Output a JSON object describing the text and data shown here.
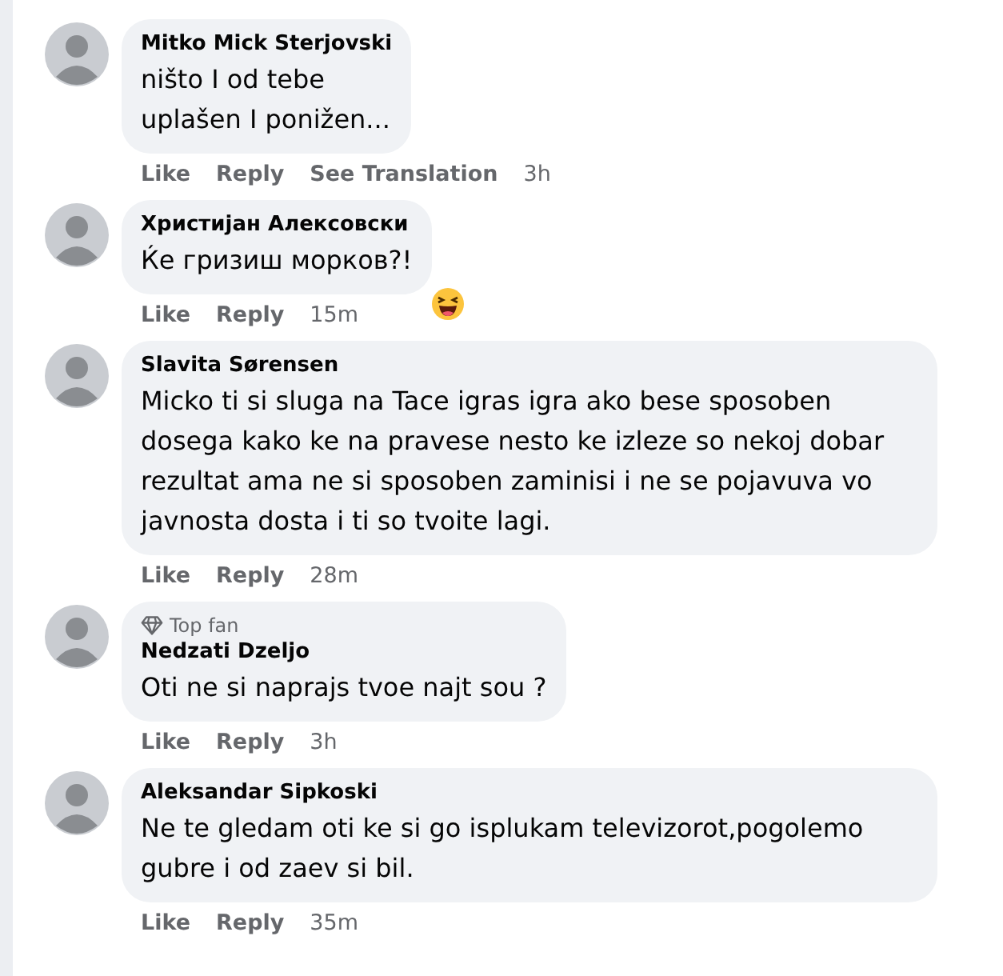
{
  "comments": [
    {
      "author": "Mitko Mick Sterjovski",
      "text": "ništo I od tebe\nuplašen I ponižen...",
      "actions": [
        "Like",
        "Reply",
        "See Translation"
      ],
      "time": "3h"
    },
    {
      "author": "Христијан Алексовски",
      "text": "Ќе гризиш морков?!",
      "actions": [
        "Like",
        "Reply"
      ],
      "time": "15m",
      "reaction": {
        "kind": "laugh"
      }
    },
    {
      "author": "Slavita Sørensen",
      "text": "Micko ti si sluga na Tace igras igra ako bese sposoben dosega kako ke na pravese nesto ke izleze so nekoj dobar rezultat ama ne si sposoben zaminisi i ne se pojavuva vo javnosta dosta i ti so tvoite lagi.",
      "actions": [
        "Like",
        "Reply"
      ],
      "time": "28m"
    },
    {
      "badge": "Top fan",
      "author": "Nedzati Dzeljo",
      "text": "Oti ne si naprajs tvoe najt sou ?",
      "actions": [
        "Like",
        "Reply"
      ],
      "time": "3h"
    },
    {
      "author": "Aleksandar Sipkoski",
      "text": "Ne te gledam oti ke si go isplukam televizorot,pogolemo gubre i od zaev si bil.",
      "actions": [
        "Like",
        "Reply"
      ],
      "time": "35m"
    }
  ]
}
